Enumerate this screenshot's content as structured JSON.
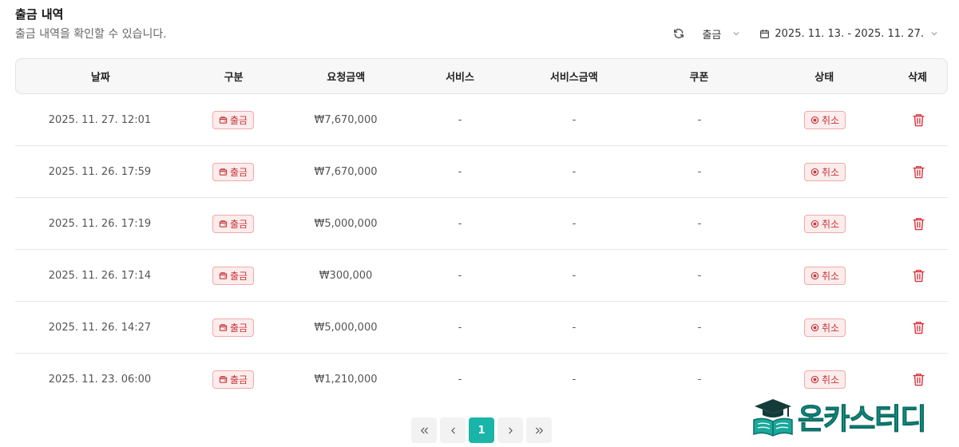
{
  "header": {
    "title": "출금 내역",
    "subtitle": "출금 내역을 확인할 수 있습니다."
  },
  "toolbar": {
    "refresh_icon": "refresh-icon",
    "type_filter": "출금",
    "date_range": "2025. 11. 13. - 2025. 11. 27."
  },
  "table": {
    "columns": [
      "날짜",
      "구분",
      "요청금액",
      "서비스",
      "서비스금액",
      "쿠폰",
      "상태",
      "삭제"
    ],
    "rows": [
      {
        "date": "2025. 11. 27. 12:01",
        "type": "출금",
        "amount": "₩7,670,000",
        "service": "-",
        "service_amount": "-",
        "coupon": "-",
        "status": "취소"
      },
      {
        "date": "2025. 11. 26. 17:59",
        "type": "출금",
        "amount": "₩7,670,000",
        "service": "-",
        "service_amount": "-",
        "coupon": "-",
        "status": "취소"
      },
      {
        "date": "2025. 11. 26. 17:19",
        "type": "출금",
        "amount": "₩5,000,000",
        "service": "-",
        "service_amount": "-",
        "coupon": "-",
        "status": "취소"
      },
      {
        "date": "2025. 11. 26. 17:14",
        "type": "출금",
        "amount": "₩300,000",
        "service": "-",
        "service_amount": "-",
        "coupon": "-",
        "status": "취소"
      },
      {
        "date": "2025. 11. 26. 14:27",
        "type": "출금",
        "amount": "₩5,000,000",
        "service": "-",
        "service_amount": "-",
        "coupon": "-",
        "status": "취소"
      },
      {
        "date": "2025. 11. 23. 06:00",
        "type": "출금",
        "amount": "₩1,210,000",
        "service": "-",
        "service_amount": "-",
        "coupon": "-",
        "status": "취소"
      }
    ]
  },
  "pagination": {
    "current_page": "1"
  },
  "watermark": {
    "text": "온카스터디"
  },
  "colors": {
    "accent": "#19b5a8",
    "danger": "#c6363b",
    "danger_bg": "#fdecec"
  }
}
